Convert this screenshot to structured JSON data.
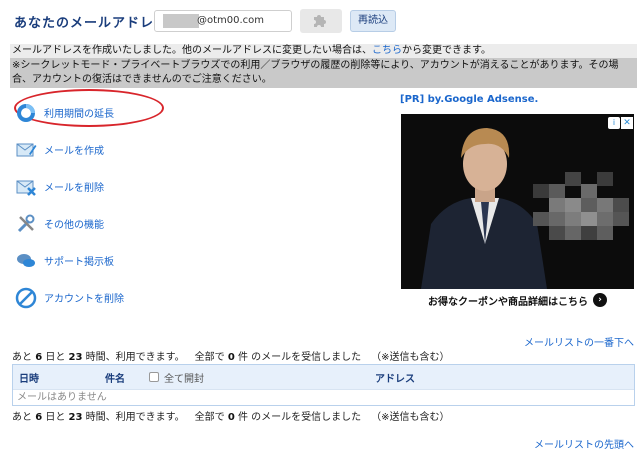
{
  "header": {
    "mail_label": "あなたのメールアドレス",
    "address": "@otm00.com",
    "reload_label": "再読込",
    "puzzle_icon": "puzzle-icon"
  },
  "notices": {
    "line1_before": "メールアドレスを作成いたしました。他のメールアドレスに変更したい場合は、",
    "line1_link": "こちら",
    "line1_after": "から変更できます。",
    "line2": "※シークレットモード・プライベートブラウズでの利用／ブラウザの履歴の削除等により、アカウントが消えることがあります。その場合、アカウントの復活はできませんのでご注意ください。"
  },
  "menu": {
    "items": [
      {
        "label": "利用期間の延長",
        "icon": "extend-icon"
      },
      {
        "label": "メールを作成",
        "icon": "compose-icon"
      },
      {
        "label": "メールを削除",
        "icon": "delete-mail-icon"
      },
      {
        "label": "その他の機能",
        "icon": "tools-icon"
      },
      {
        "label": "サポート掲示板",
        "icon": "chat-icon"
      },
      {
        "label": "アカウントを削除",
        "icon": "delete-account-icon"
      }
    ]
  },
  "ad": {
    "label": "[PR] by.Google Adsense.",
    "caption": "お得なクーポンや商品詳細はこちら"
  },
  "mail_list": {
    "top_link": "メールリストの一番下へ",
    "status_days_prefix": "あと",
    "days": "6",
    "days_unit": "日と",
    "hours": "23",
    "hours_unit": "時間、利用できます。",
    "total_prefix": "全部で",
    "count": "0",
    "total_suffix": "件 のメールを受信しました",
    "note": "（※送信も含む）",
    "columns": {
      "date": "日時",
      "subject": "件名",
      "open_all": "全て開封",
      "address": "アドレス"
    },
    "empty": "メールはありません",
    "first_link": "メールリストの先頭へ"
  },
  "colors": {
    "accent": "#1a66cc",
    "highlight": "#d8252b",
    "table_head": "#e7f0fb"
  }
}
